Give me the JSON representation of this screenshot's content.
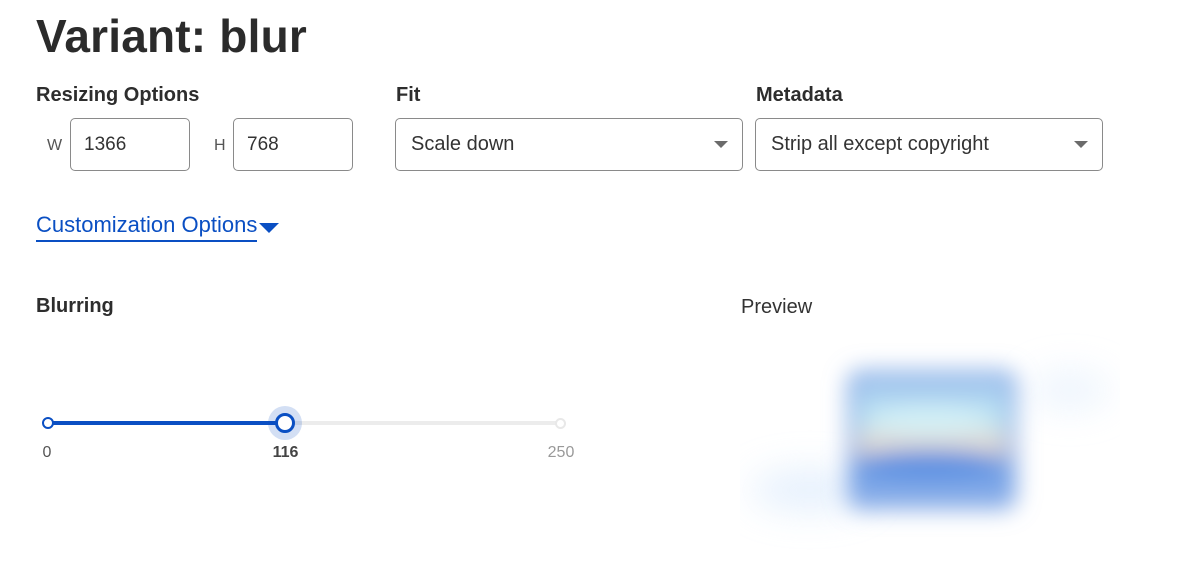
{
  "page": {
    "title": "Variant: blur"
  },
  "resizing": {
    "label": "Resizing Options",
    "width_letter": "W",
    "height_letter": "H",
    "width_value": "1366",
    "height_value": "768"
  },
  "fit": {
    "label": "Fit",
    "selected": "Scale down"
  },
  "metadata": {
    "label": "Metadata",
    "selected": "Strip all except copyright"
  },
  "customization": {
    "link_label": "Customization Options"
  },
  "blurring": {
    "label": "Blurring",
    "min": 0,
    "max": 250,
    "value": 116,
    "min_label": "0",
    "max_label": "250",
    "value_label": "116"
  },
  "preview": {
    "label": "Preview"
  },
  "colors": {
    "accent": "#0a4fc3",
    "text": "#2d2d2d",
    "border": "#8a8a8a"
  }
}
